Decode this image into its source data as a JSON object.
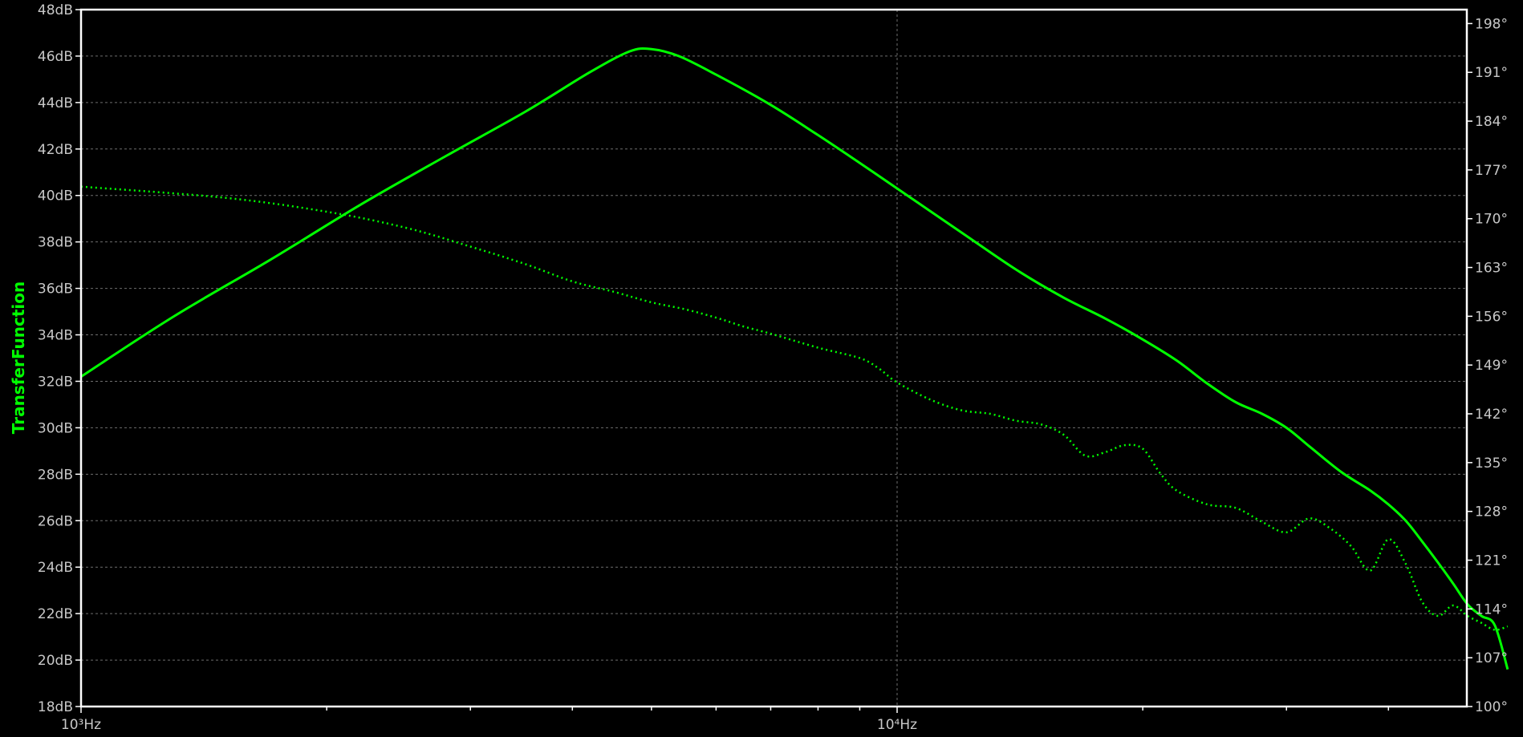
{
  "chart_data": {
    "type": "line",
    "title": "",
    "ylabel": "TransferFunction",
    "x_axis": {
      "scale": "log",
      "range": [
        1000,
        17000
      ],
      "major_tick_labels": [
        "10³Hz",
        "10⁴Hz"
      ]
    },
    "y_left": {
      "unit": "dB",
      "range": [
        18,
        48
      ],
      "tick_labels": [
        "48dB",
        "46dB",
        "44dB",
        "42dB",
        "40dB",
        "38dB",
        "36dB",
        "34dB",
        "32dB",
        "30dB",
        "28dB",
        "26dB",
        "24dB",
        "22dB",
        "20dB",
        "18dB"
      ]
    },
    "y_right": {
      "unit": "°",
      "range": [
        100,
        200
      ],
      "tick_labels": [
        "198°",
        "191°",
        "184°",
        "177°",
        "170°",
        "163°",
        "156°",
        "149°",
        "142°",
        "135°",
        "128°",
        "121°",
        "114°",
        "107°",
        "100°"
      ]
    },
    "grid": true,
    "colors": {
      "trace": "#00ff00",
      "grid": "#6e6e6e",
      "frame": "#ffffff",
      "text": "#c8c8c8",
      "background": "#000000"
    },
    "series": [
      {
        "kind": "magnitude",
        "axis": "left",
        "style": "solid",
        "x": [
          1000,
          1300,
          1700,
          2200,
          2800,
          3500,
          4200,
          4700,
          5000,
          5400,
          6000,
          7000,
          8000,
          9000,
          10000,
          12000,
          14000,
          16000,
          18000,
          20000,
          22000,
          24000,
          26000,
          28000,
          30000,
          32000,
          35000,
          38000,
          40000,
          42000,
          44000,
          46000,
          48000,
          50000,
          52000,
          54000,
          56000
        ],
        "y": [
          32.2,
          34.8,
          37.2,
          39.6,
          41.7,
          43.6,
          45.3,
          46.2,
          46.3,
          46.0,
          45.2,
          43.9,
          42.6,
          41.4,
          40.3,
          38.4,
          36.8,
          35.6,
          34.7,
          33.8,
          32.9,
          31.9,
          31.1,
          30.6,
          30.0,
          29.2,
          28.1,
          27.3,
          26.7,
          26.0,
          25.1,
          24.2,
          23.3,
          22.4,
          21.9,
          21.5,
          19.6
        ]
      },
      {
        "kind": "phase",
        "axis": "right",
        "style": "dotted",
        "x": [
          1000,
          1500,
          2000,
          2500,
          3000,
          3500,
          4000,
          4500,
          5000,
          5500,
          6000,
          6500,
          7000,
          8000,
          9000,
          9500,
          10000,
          11000,
          12000,
          13000,
          14000,
          15000,
          16000,
          17000,
          18000,
          19000,
          20000,
          21000,
          22000,
          24000,
          26000,
          28000,
          30000,
          32000,
          34000,
          36000,
          38000,
          40000,
          42000,
          44000,
          46000,
          48000,
          50000,
          52000,
          54000,
          56000
        ],
        "y": [
          174.6,
          173.0,
          171.0,
          168.7,
          166.0,
          163.5,
          161.0,
          159.5,
          158.0,
          157.0,
          155.8,
          154.5,
          153.5,
          151.5,
          150.0,
          148.5,
          146.5,
          144.0,
          142.5,
          142.0,
          141.0,
          140.5,
          139.0,
          136.0,
          136.5,
          137.5,
          137.0,
          133.5,
          131.0,
          129.0,
          128.5,
          126.5,
          125.0,
          127.0,
          125.5,
          123.0,
          119.5,
          124.0,
          120.5,
          115.0,
          113.0,
          114.5,
          113.0,
          112.0,
          111.0,
          111.5
        ]
      }
    ]
  }
}
